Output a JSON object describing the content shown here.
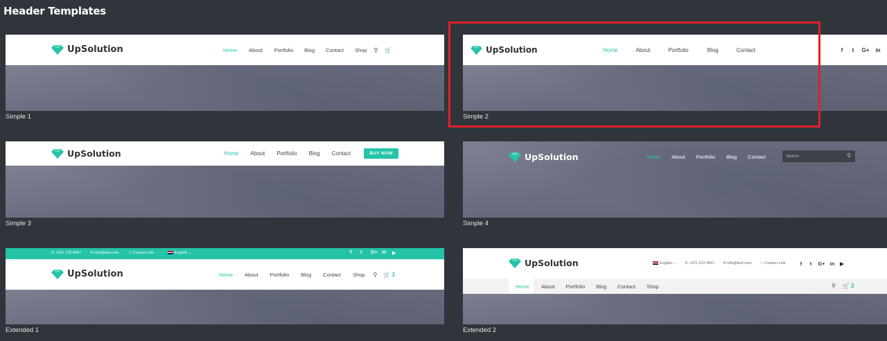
{
  "page": {
    "title": "Header Templates"
  },
  "brand": {
    "name": "UpSolution",
    "accent": "#25c3a8",
    "highlight": "#e0202a"
  },
  "simple1": {
    "caption": "Simple 1",
    "nav": [
      "Home",
      "About",
      "Portfolio",
      "Blog",
      "Contact",
      "Shop"
    ],
    "icons": [
      "search-icon",
      "cart-icon"
    ]
  },
  "simple2": {
    "caption": "Simple 2",
    "nav": [
      "Home",
      "About",
      "Portfolio",
      "Blog",
      "Contact"
    ],
    "social": [
      "f",
      "t",
      "G+",
      "in"
    ]
  },
  "simple3": {
    "caption": "Simple 3",
    "nav": [
      "Home",
      "About",
      "Portfolio",
      "Blog",
      "Contact"
    ],
    "button": "BUY NOW"
  },
  "simple4": {
    "caption": "Simple 4",
    "nav": [
      "Home",
      "About",
      "Portfolio",
      "Blog",
      "Contact"
    ],
    "search_placeholder": "Search"
  },
  "extended1": {
    "caption": "Extended 1",
    "phone": "+321 123 4567",
    "email": "info@test.com",
    "custom_link": "Custom Link",
    "language": "English",
    "social": [
      "f",
      "t",
      "G+",
      "in",
      "yt"
    ],
    "nav": [
      "Home",
      "About",
      "Portfolio",
      "Blog",
      "Contact",
      "Shop"
    ],
    "cart_count": "3"
  },
  "extended2": {
    "caption": "Extended 2",
    "language": "English",
    "phone": "+321 123 4567",
    "email": "info@test.com",
    "custom_link": "Custom Link",
    "social": [
      "f",
      "t",
      "G+",
      "in",
      "yt"
    ],
    "nav": [
      "Home",
      "About",
      "Portfolio",
      "Blog",
      "Contact",
      "Shop"
    ],
    "cart_count": "3"
  }
}
